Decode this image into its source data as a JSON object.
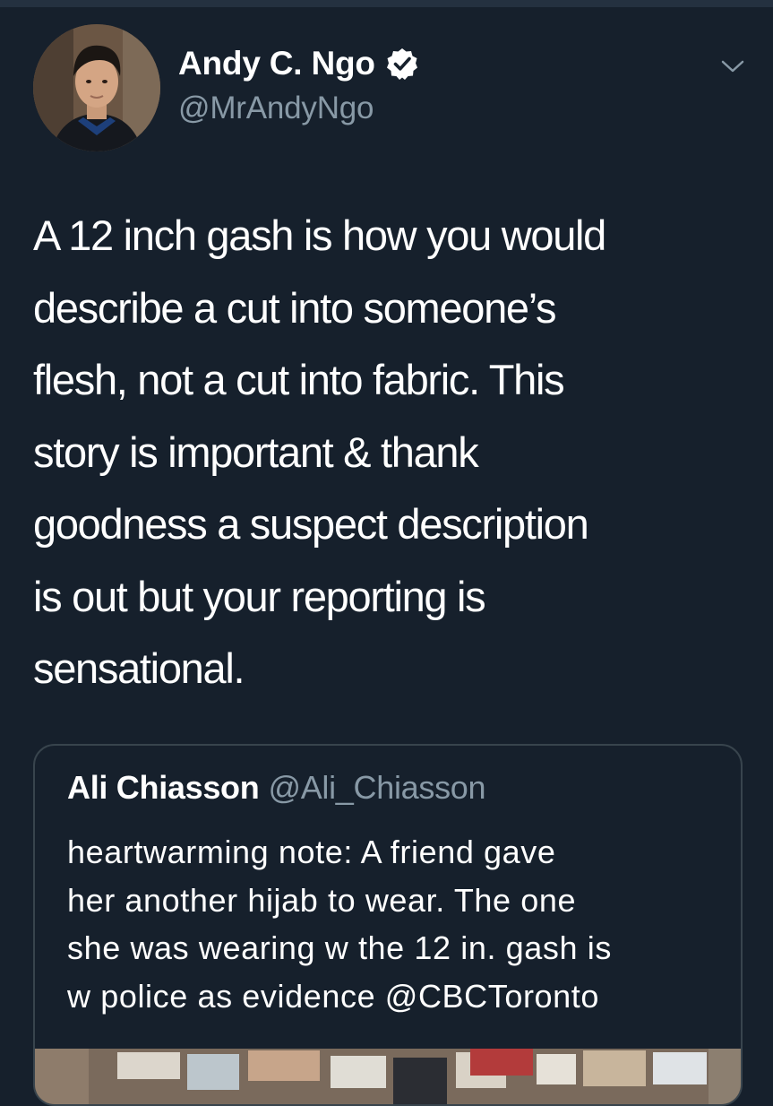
{
  "author": {
    "name": "Andy C. Ngo",
    "handle": "@MrAndyNgo",
    "verified": true
  },
  "icons": {
    "verified": "verified-badge-icon",
    "menu": "chevron-down-icon"
  },
  "tweet": {
    "text": "A 12 inch gash is how you would\ndescribe a cut into someone’s\nflesh, not a cut into fabric. This\nstory is important & thank\ngoodness a suspect description\nis out but your reporting is\nsensational."
  },
  "quoted_tweet": {
    "name": "Ali Chiasson",
    "handle": "@Ali_Chiasson",
    "text": "heartwarming note: A friend gave\nher another hijab to wear. The one\nshe was wearing w the 12 in. gash is\nw police as evidence @CBCToronto"
  },
  "colors": {
    "background": "#16202c",
    "secondary_text": "#8899a6",
    "border": "#38444d"
  }
}
